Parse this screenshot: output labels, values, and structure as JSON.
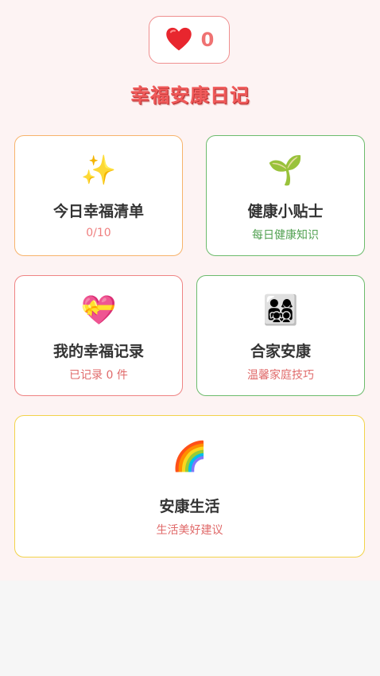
{
  "header": {
    "heart_icon": "heart-icon",
    "heart_count": "0",
    "title": "幸福安康日记"
  },
  "cards": [
    {
      "id": "happiness-list",
      "icon": "✨",
      "icon_name": "sparkles-icon",
      "label": "今日幸福清单",
      "subtitle": "0/10",
      "border_color": "#f7b36b"
    },
    {
      "id": "health-tips",
      "icon": "🌱",
      "icon_name": "seedling-icon",
      "label": "健康小贴士",
      "subtitle": "每日健康知识",
      "border_color": "#6cbb6c"
    },
    {
      "id": "happiness-records",
      "icon": "💝",
      "icon_name": "heart-gift-icon",
      "label": "我的幸福记录",
      "subtitle": "已记录 0 件",
      "border_color": "#ef8383"
    },
    {
      "id": "family-peace",
      "icon": "👨‍👩‍👧‍👦",
      "icon_name": "family-icon",
      "label": "合家安康",
      "subtitle": "温馨家庭技巧",
      "border_color": "#6cbb6c"
    },
    {
      "id": "healthy-life",
      "icon": "🌈",
      "icon_name": "rainbow-icon",
      "label": "安康生活",
      "subtitle": "生活美好建议",
      "border_color": "#f2d34a"
    }
  ],
  "colors": {
    "accent": "#f05a5a",
    "background": "#fdf3f3"
  }
}
